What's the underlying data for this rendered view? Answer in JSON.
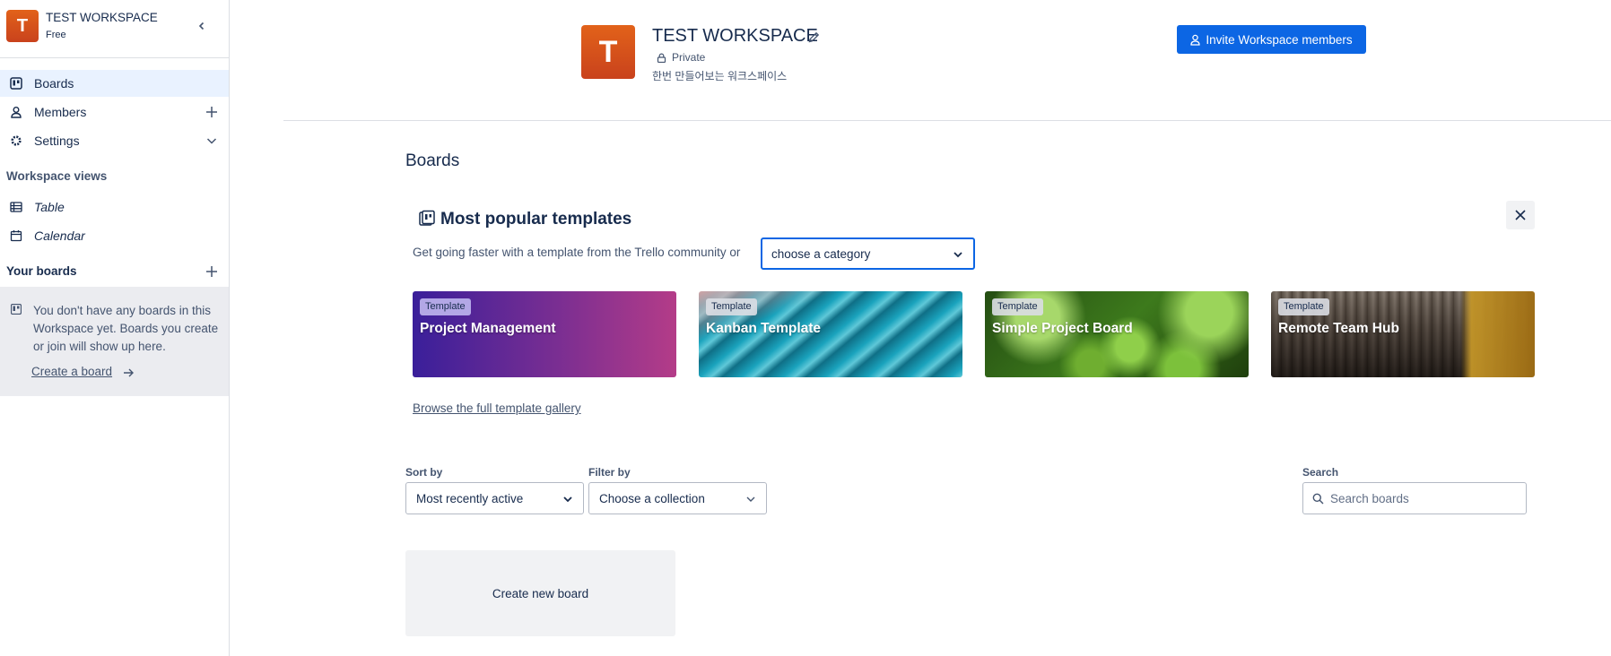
{
  "sidebar": {
    "workspace_initial": "T",
    "workspace_name": "TEST WORKSPACE",
    "workspace_plan": "Free",
    "nav": {
      "boards": "Boards",
      "members": "Members",
      "settings": "Settings"
    },
    "workspace_views_title": "Workspace views",
    "views": {
      "table": "Table",
      "calendar": "Calendar"
    },
    "your_boards_title": "Your boards",
    "empty_message": "You don't have any boards in this Workspace yet. Boards you create or join will show up here.",
    "create_board_link": "Create a board"
  },
  "header": {
    "avatar_initial": "T",
    "title": "TEST WORKSPACE",
    "privacy": "Private",
    "description": "한번 만들어보는 워크스페이스",
    "invite_button": "Invite Workspace members"
  },
  "main": {
    "heading": "Boards",
    "templates": {
      "title": "Most popular templates",
      "subtitle": "Get going faster with a template from the Trello community or",
      "category_select": "choose a category",
      "cards": [
        {
          "badge": "Template",
          "name": "Project Management"
        },
        {
          "badge": "Template",
          "name": "Kanban Template"
        },
        {
          "badge": "Template",
          "name": "Simple Project Board"
        },
        {
          "badge": "Template",
          "name": "Remote Team Hub"
        }
      ],
      "gallery_link": "Browse the full template gallery"
    },
    "controls": {
      "sort_label": "Sort by",
      "sort_value": "Most recently active",
      "filter_label": "Filter by",
      "filter_value": "Choose a collection",
      "search_label": "Search",
      "search_placeholder": "Search boards"
    },
    "create_new_board": "Create new board"
  },
  "colors": {
    "accent": "#0c66e4",
    "avatar": "#d9531e",
    "active_nav_bg": "#e9f2ff",
    "text": "#172b4d"
  }
}
